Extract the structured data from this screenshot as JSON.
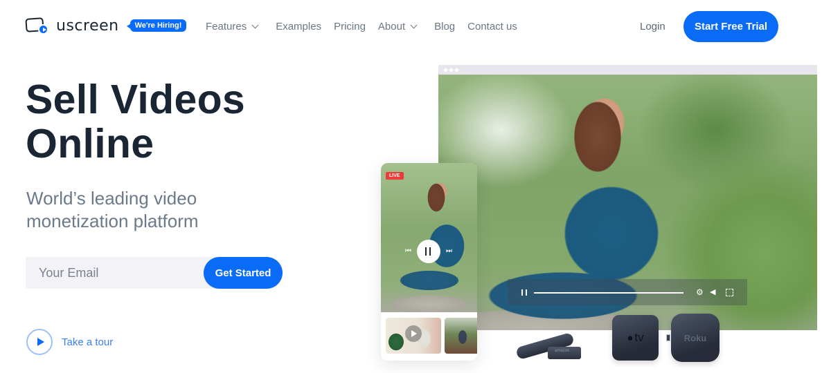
{
  "header": {
    "logo_text": "uscreen",
    "hiring_badge": "We're Hiring!",
    "nav": [
      {
        "label": "Features",
        "has_dropdown": true
      },
      {
        "label": "Examples",
        "has_dropdown": false
      },
      {
        "label": "Pricing",
        "has_dropdown": false
      },
      {
        "label": "About",
        "has_dropdown": true
      },
      {
        "label": "Blog",
        "has_dropdown": false
      },
      {
        "label": "Contact us",
        "has_dropdown": false
      }
    ],
    "login_label": "Login",
    "cta_label": "Start Free Trial"
  },
  "hero": {
    "title_line1": "Sell Videos",
    "title_line2": "Online",
    "subtitle_line1": "World’s leading video",
    "subtitle_line2": "monetization platform",
    "email_placeholder": "Your Email",
    "email_value": "",
    "submit_label": "Get Started",
    "tour_label": "Take a tour"
  },
  "visual": {
    "live_badge": "LIVE",
    "player_icons": [
      "pause-icon",
      "gear-icon",
      "volume-icon",
      "fullscreen-icon"
    ],
    "phone_icons": [
      "previous-icon",
      "pause-icon",
      "next-icon"
    ],
    "devices": [
      {
        "name": "Amazon Fire TV Stick",
        "label": "amazon"
      },
      {
        "name": "Apple TV",
        "label": "tv"
      },
      {
        "name": "Roku",
        "label": "Roku"
      }
    ],
    "apple_tv_label": "tv",
    "roku_label": "Roku",
    "amazon_label": "amazon"
  },
  "colors": {
    "brand_blue": "#0a6cf6",
    "heading": "#1a2634",
    "subtext": "#6b7a8a",
    "live_red": "#ef3a3a"
  }
}
